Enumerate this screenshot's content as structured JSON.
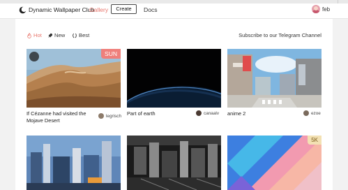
{
  "header": {
    "brand": "Dynamic Wallpaper Club",
    "nav": {
      "gallery": "Gallery",
      "create": "Create",
      "docs": "Docs"
    },
    "user": {
      "name": "feb",
      "avatar": "avatar-image"
    }
  },
  "filters": {
    "items": [
      {
        "label": "Hot",
        "icon": "flame-icon",
        "active": true
      },
      {
        "label": "New",
        "icon": "rocket-icon",
        "active": false
      },
      {
        "label": "Best",
        "icon": "laurel-icon",
        "active": false
      }
    ],
    "telegram": "Subscribe to our Telegram Channel"
  },
  "cards": [
    {
      "title": "If Cézanne had visited the Mojave Desert",
      "author": "legrisch",
      "badge": "SUN",
      "image": "desert-dunes"
    },
    {
      "title": "Part of earth",
      "author": "canaalv",
      "badge": "",
      "image": "earth-from-space"
    },
    {
      "title": "anime 2",
      "author": "ezoe",
      "badge": "",
      "image": "anime-street"
    },
    {
      "title": "",
      "author": "",
      "badge": "",
      "image": "futuristic-city"
    },
    {
      "title": "",
      "author": "",
      "badge": "",
      "image": "monochrome-city"
    },
    {
      "title": "",
      "author": "",
      "badge": "5K",
      "image": "abstract-pink-shapes"
    }
  ],
  "colors": {
    "accent": "#e8766c",
    "sidebar": "#f2f2f2",
    "sun_badge": "#ef7f7b",
    "k5_badge": "#f3e1b3"
  }
}
